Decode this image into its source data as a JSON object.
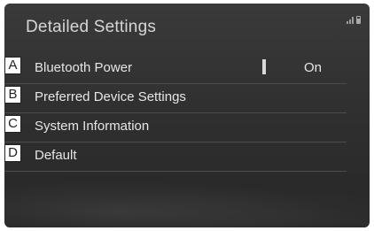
{
  "header": {
    "title": "Detailed Settings"
  },
  "status_icons": [
    "signal-icon",
    "battery-icon"
  ],
  "items": [
    {
      "callout": "A",
      "label": "Bluetooth Power",
      "value": "On"
    },
    {
      "callout": "B",
      "label": "Preferred Device Settings"
    },
    {
      "callout": "C",
      "label": "System Information"
    },
    {
      "callout": "D",
      "label": "Default"
    }
  ]
}
